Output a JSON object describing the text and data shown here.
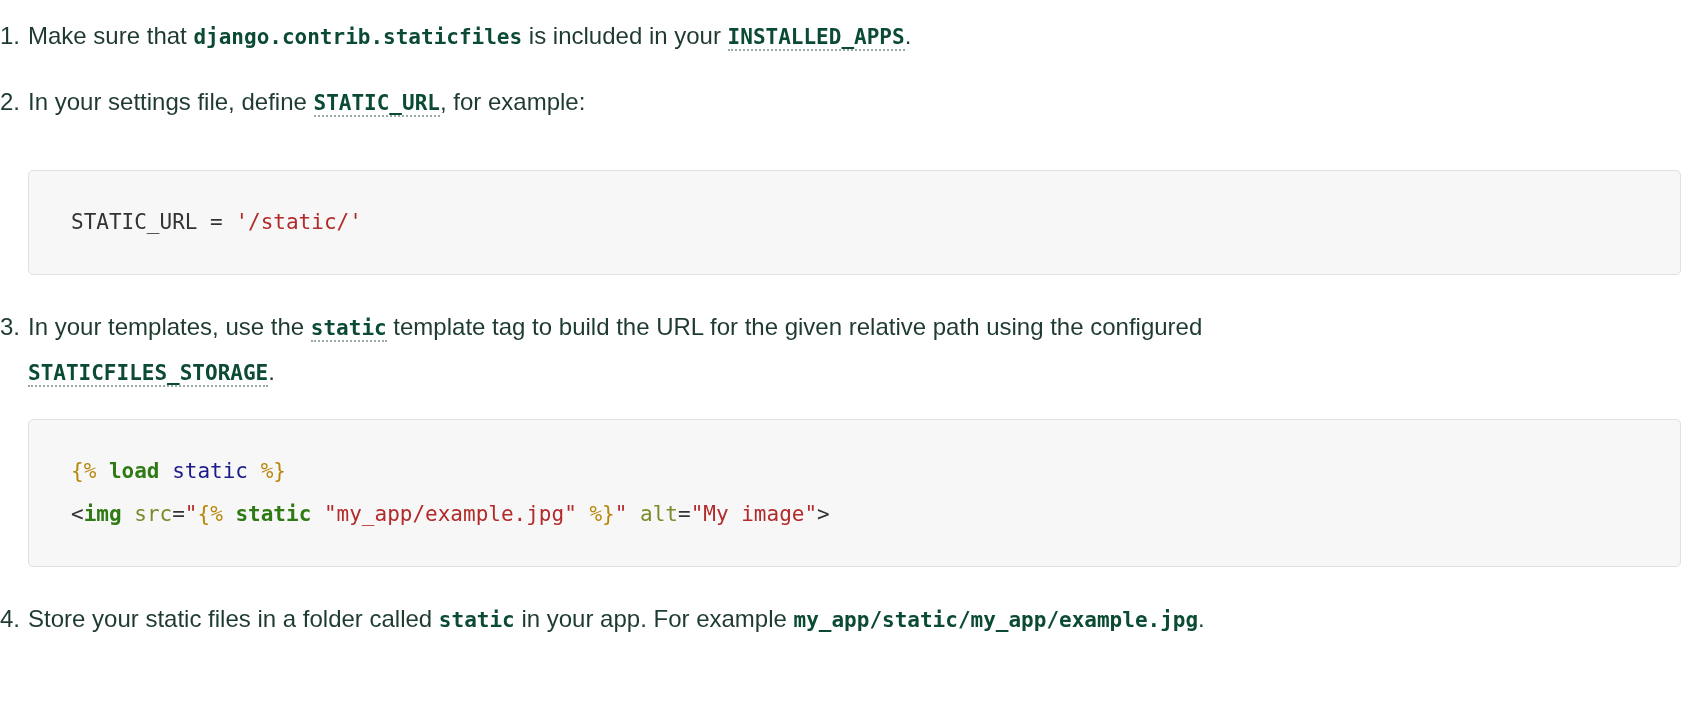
{
  "steps": [
    {
      "number": "1.",
      "segments": [
        {
          "kind": "text",
          "text": "Make sure that "
        },
        {
          "kind": "code",
          "text": "django.contrib.staticfiles"
        },
        {
          "kind": "text",
          "text": " is included in your "
        },
        {
          "kind": "ref",
          "text": "INSTALLED_APPS"
        },
        {
          "kind": "text",
          "text": "."
        }
      ]
    },
    {
      "number": "2.",
      "segments": [
        {
          "kind": "text",
          "text": "In your settings file, define "
        },
        {
          "kind": "ref",
          "text": "STATIC_URL"
        },
        {
          "kind": "text",
          "text": ", for example:"
        }
      ],
      "code_block": [
        [
          {
            "kind": "plain",
            "text": "STATIC_URL = "
          },
          {
            "kind": "string",
            "text": "'/static/'"
          }
        ]
      ]
    },
    {
      "number": "3.",
      "segments": [
        {
          "kind": "text",
          "text": "In your templates, use the "
        },
        {
          "kind": "ref",
          "text": "static"
        },
        {
          "kind": "text",
          "text": " template tag to build the URL for the given relative path using the configured "
        },
        {
          "kind": "ref",
          "text": "STATICFILES_STORAGE"
        },
        {
          "kind": "text",
          "text": "."
        }
      ],
      "code_block": [
        [
          {
            "kind": "tag",
            "text": "{% "
          },
          {
            "kind": "keyword",
            "text": "load "
          },
          {
            "kind": "name",
            "text": "static "
          },
          {
            "kind": "tag",
            "text": "%}"
          }
        ],
        [
          {
            "kind": "plain",
            "text": "<"
          },
          {
            "kind": "keyword",
            "text": "img "
          },
          {
            "kind": "attr",
            "text": "src"
          },
          {
            "kind": "plain",
            "text": "="
          },
          {
            "kind": "string",
            "text": "\""
          },
          {
            "kind": "tag",
            "text": "{% "
          },
          {
            "kind": "keyword",
            "text": "static "
          },
          {
            "kind": "string",
            "text": "\"my_app/example.jpg\" "
          },
          {
            "kind": "tag",
            "text": "%}"
          },
          {
            "kind": "string",
            "text": "\" "
          },
          {
            "kind": "attr",
            "text": "alt"
          },
          {
            "kind": "plain",
            "text": "="
          },
          {
            "kind": "string",
            "text": "\"My image\""
          },
          {
            "kind": "plain",
            "text": ">"
          }
        ]
      ]
    },
    {
      "number": "4.",
      "segments": [
        {
          "kind": "text",
          "text": "Store your static files in a folder called "
        },
        {
          "kind": "code",
          "text": "static"
        },
        {
          "kind": "text",
          "text": " in your app. For example "
        },
        {
          "kind": "code",
          "text": "my_app/static/my_app/example.jpg"
        },
        {
          "kind": "text",
          "text": "."
        }
      ]
    }
  ]
}
